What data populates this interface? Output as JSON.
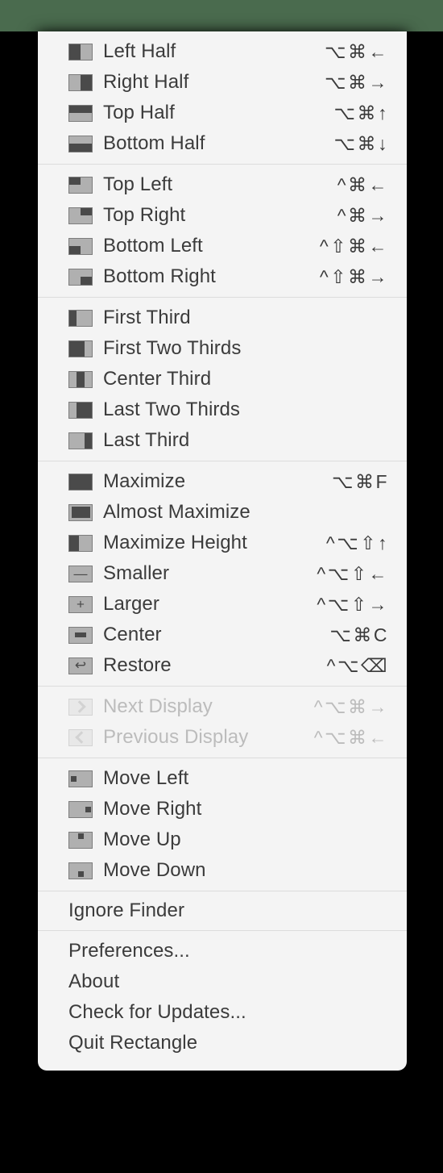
{
  "window": {
    "app_name": "Rectangle",
    "menu_kind": "status-bar-menu",
    "desktop_color": "#4a6b4e",
    "menu_background": "#f4f4f4",
    "text_color": "#3b3b3b",
    "disabled_text_color": "#bcbcbc",
    "icon_active_color": "#4a4a4a",
    "icon_inactive_color": "#b0b0b0"
  },
  "groups": [
    {
      "name": "halves",
      "items": [
        {
          "label": "Left Half",
          "shortcut": "⌥⌘←",
          "icon": "half-left",
          "enabled": true
        },
        {
          "label": "Right Half",
          "shortcut": "⌥⌘→",
          "icon": "half-right",
          "enabled": true
        },
        {
          "label": "Top Half",
          "shortcut": "⌥⌘↑",
          "icon": "half-top",
          "enabled": true
        },
        {
          "label": "Bottom Half",
          "shortcut": "⌥⌘↓",
          "icon": "half-bottom",
          "enabled": true
        }
      ]
    },
    {
      "name": "quadrants",
      "items": [
        {
          "label": "Top Left",
          "shortcut": "^⌘←",
          "icon": "quad-top-left",
          "enabled": true
        },
        {
          "label": "Top Right",
          "shortcut": "^⌘→",
          "icon": "quad-top-right",
          "enabled": true
        },
        {
          "label": "Bottom Left",
          "shortcut": "^⇧⌘←",
          "icon": "quad-bottom-left",
          "enabled": true
        },
        {
          "label": "Bottom Right",
          "shortcut": "^⇧⌘→",
          "icon": "quad-bottom-right",
          "enabled": true
        }
      ]
    },
    {
      "name": "thirds",
      "items": [
        {
          "label": "First Third",
          "shortcut": "",
          "icon": "third-first",
          "enabled": true
        },
        {
          "label": "First Two Thirds",
          "shortcut": "",
          "icon": "third-first-two",
          "enabled": true
        },
        {
          "label": "Center Third",
          "shortcut": "",
          "icon": "third-center",
          "enabled": true
        },
        {
          "label": "Last Two Thirds",
          "shortcut": "",
          "icon": "third-last-two",
          "enabled": true
        },
        {
          "label": "Last Third",
          "shortcut": "",
          "icon": "third-last",
          "enabled": true
        }
      ]
    },
    {
      "name": "sizing",
      "items": [
        {
          "label": "Maximize",
          "shortcut": "⌥⌘F",
          "icon": "maximize",
          "enabled": true
        },
        {
          "label": "Almost Maximize",
          "shortcut": "",
          "icon": "almost-maximize",
          "enabled": true
        },
        {
          "label": "Maximize Height",
          "shortcut": "^⌥⇧↑",
          "icon": "maximize-height",
          "enabled": true
        },
        {
          "label": "Smaller",
          "shortcut": "^⌥⇧←",
          "icon": "smaller",
          "enabled": true
        },
        {
          "label": "Larger",
          "shortcut": "^⌥⇧→",
          "icon": "larger",
          "enabled": true
        },
        {
          "label": "Center",
          "shortcut": "⌥⌘C",
          "icon": "center",
          "enabled": true
        },
        {
          "label": "Restore",
          "shortcut": "^⌥⌫",
          "icon": "restore",
          "enabled": true
        }
      ]
    },
    {
      "name": "displays",
      "items": [
        {
          "label": "Next Display",
          "shortcut": "^⌥⌘→",
          "icon": "next-display",
          "enabled": false
        },
        {
          "label": "Previous Display",
          "shortcut": "^⌥⌘←",
          "icon": "previous-display",
          "enabled": false
        }
      ]
    },
    {
      "name": "move",
      "items": [
        {
          "label": "Move Left",
          "shortcut": "",
          "icon": "move-left",
          "enabled": true
        },
        {
          "label": "Move Right",
          "shortcut": "",
          "icon": "move-right",
          "enabled": true
        },
        {
          "label": "Move Up",
          "shortcut": "",
          "icon": "move-up",
          "enabled": true
        },
        {
          "label": "Move Down",
          "shortcut": "",
          "icon": "move-down",
          "enabled": true
        }
      ]
    },
    {
      "name": "ignore",
      "items": [
        {
          "label": "Ignore Finder",
          "shortcut": "",
          "icon": "",
          "enabled": true
        }
      ]
    },
    {
      "name": "app",
      "items": [
        {
          "label": "Preferences...",
          "shortcut": "",
          "icon": "",
          "enabled": true
        },
        {
          "label": "About",
          "shortcut": "",
          "icon": "",
          "enabled": true
        },
        {
          "label": "Check for Updates...",
          "shortcut": "",
          "icon": "",
          "enabled": true
        },
        {
          "label": "Quit Rectangle",
          "shortcut": "",
          "icon": "",
          "enabled": true
        }
      ]
    }
  ]
}
